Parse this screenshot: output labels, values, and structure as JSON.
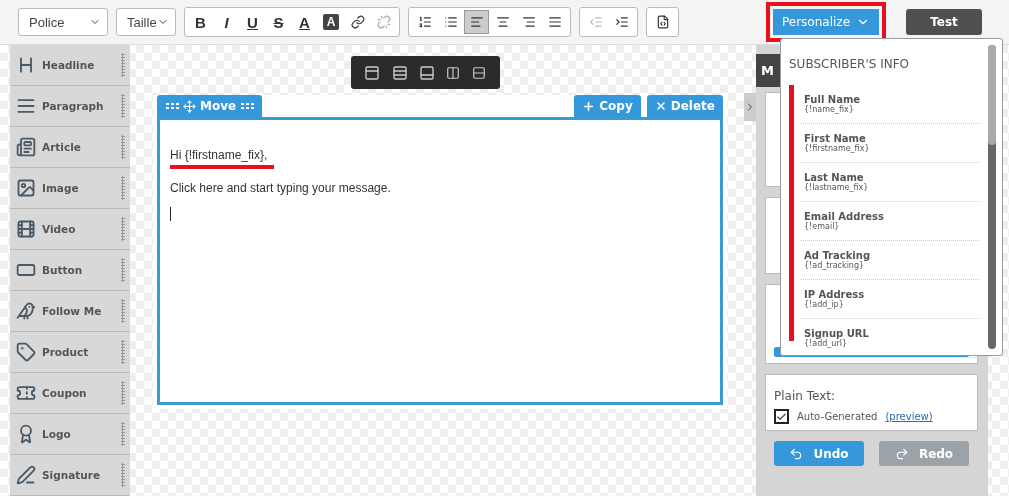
{
  "toolbar": {
    "font_select": {
      "value": "Police"
    },
    "size_select": {
      "value": "Taille"
    },
    "format_buttons": [
      {
        "kind": "bold",
        "label": "B"
      },
      {
        "kind": "italic",
        "label": "I"
      },
      {
        "kind": "underline",
        "label": "U"
      },
      {
        "kind": "strike",
        "label": "S"
      },
      {
        "kind": "color",
        "label": "A"
      },
      {
        "kind": "highlight",
        "label": "A"
      },
      {
        "kind": "link"
      },
      {
        "kind": "unlink"
      }
    ],
    "paragraph_buttons": [
      {
        "kind": "ordered-list",
        "selected": false
      },
      {
        "kind": "bullet-list",
        "selected": false
      },
      {
        "kind": "align-left",
        "selected": true
      },
      {
        "kind": "align-center",
        "selected": false
      },
      {
        "kind": "align-right",
        "selected": false
      },
      {
        "kind": "justify",
        "selected": false
      }
    ],
    "indent_buttons": [
      {
        "kind": "outdent",
        "disabled": true
      },
      {
        "kind": "indent",
        "disabled": false
      }
    ],
    "personalize_button": {
      "label": "Personalize",
      "highlighted": true
    },
    "test_button": {
      "label": "Test"
    }
  },
  "sidebar": {
    "items": [
      {
        "kind": "headline",
        "label": "Headline"
      },
      {
        "kind": "paragraph",
        "label": "Paragraph"
      },
      {
        "kind": "article",
        "label": "Article"
      },
      {
        "kind": "image",
        "label": "Image"
      },
      {
        "kind": "video",
        "label": "Video"
      },
      {
        "kind": "button",
        "label": "Button"
      },
      {
        "kind": "bird",
        "label": "Follow Me"
      },
      {
        "kind": "tag",
        "label": "Product"
      },
      {
        "kind": "coupon",
        "label": "Coupon"
      },
      {
        "kind": "logo",
        "label": "Logo"
      },
      {
        "kind": "pen",
        "label": "Signature"
      }
    ]
  },
  "editor": {
    "move_tab": "Move",
    "copy_tab": "Copy",
    "delete_tab": "Delete",
    "lines": [
      {
        "text": "Hi {!firstname_fix},",
        "highlighted": true
      },
      {
        "text": "Click here and start typing your message.",
        "highlighted": false
      }
    ]
  },
  "right_panel": {
    "header": "M",
    "plain_text": {
      "label": "Plain Text:",
      "auto_generated": {
        "label": "Auto-Generated",
        "checked": true
      },
      "preview_link": "(preview)"
    },
    "undo_button": "Undo",
    "redo_button": {
      "label": "Redo",
      "disabled": true
    }
  },
  "personalize_menu": {
    "title": "SUBSCRIBER'S INFO",
    "items": [
      {
        "label": "Full Name",
        "tag": "{!name_fix}"
      },
      {
        "label": "First Name",
        "tag": "{!firstname_fix}"
      },
      {
        "label": "Last Name",
        "tag": "{!lastname_fix}"
      },
      {
        "label": "Email Address",
        "tag": "{!email}"
      },
      {
        "label": "Ad Tracking",
        "tag": "{!ad_tracking}"
      },
      {
        "label": "IP Address",
        "tag": "{!add_ip}"
      },
      {
        "label": "Signup URL",
        "tag": "{!add_url}"
      }
    ]
  }
}
